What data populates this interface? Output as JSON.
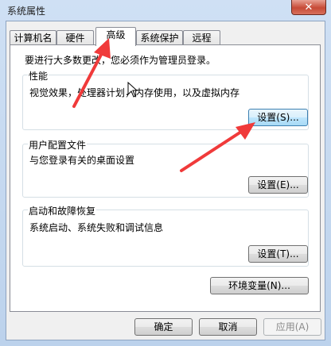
{
  "window": {
    "title": "系统属性",
    "close_glyph": "✕"
  },
  "tabs": [
    {
      "label": "计算机名",
      "active": false
    },
    {
      "label": "硬件",
      "active": false
    },
    {
      "label": "高级",
      "active": true
    },
    {
      "label": "系统保护",
      "active": false
    },
    {
      "label": "远程",
      "active": false
    }
  ],
  "notice": "要进行大多数更改，您必须作为管理员登录。",
  "performance": {
    "title": "性能",
    "description": "视觉效果，处理器计划，内存使用，以及虚拟内存",
    "button": "设置(S)..."
  },
  "user_profiles": {
    "title": "用户配置文件",
    "description": "与您登录有关的桌面设置",
    "button": "设置(E)..."
  },
  "startup_recovery": {
    "title": "启动和故障恢复",
    "description": "系统启动、系统失败和调试信息",
    "button": "设置(T)..."
  },
  "env_button": "环境变量(N)...",
  "footer": {
    "ok": "确定",
    "cancel": "取消",
    "apply": "应用(A)"
  },
  "colors": {
    "annotation_arrow": "#f03a3a",
    "accent": "#3c7fb1"
  }
}
